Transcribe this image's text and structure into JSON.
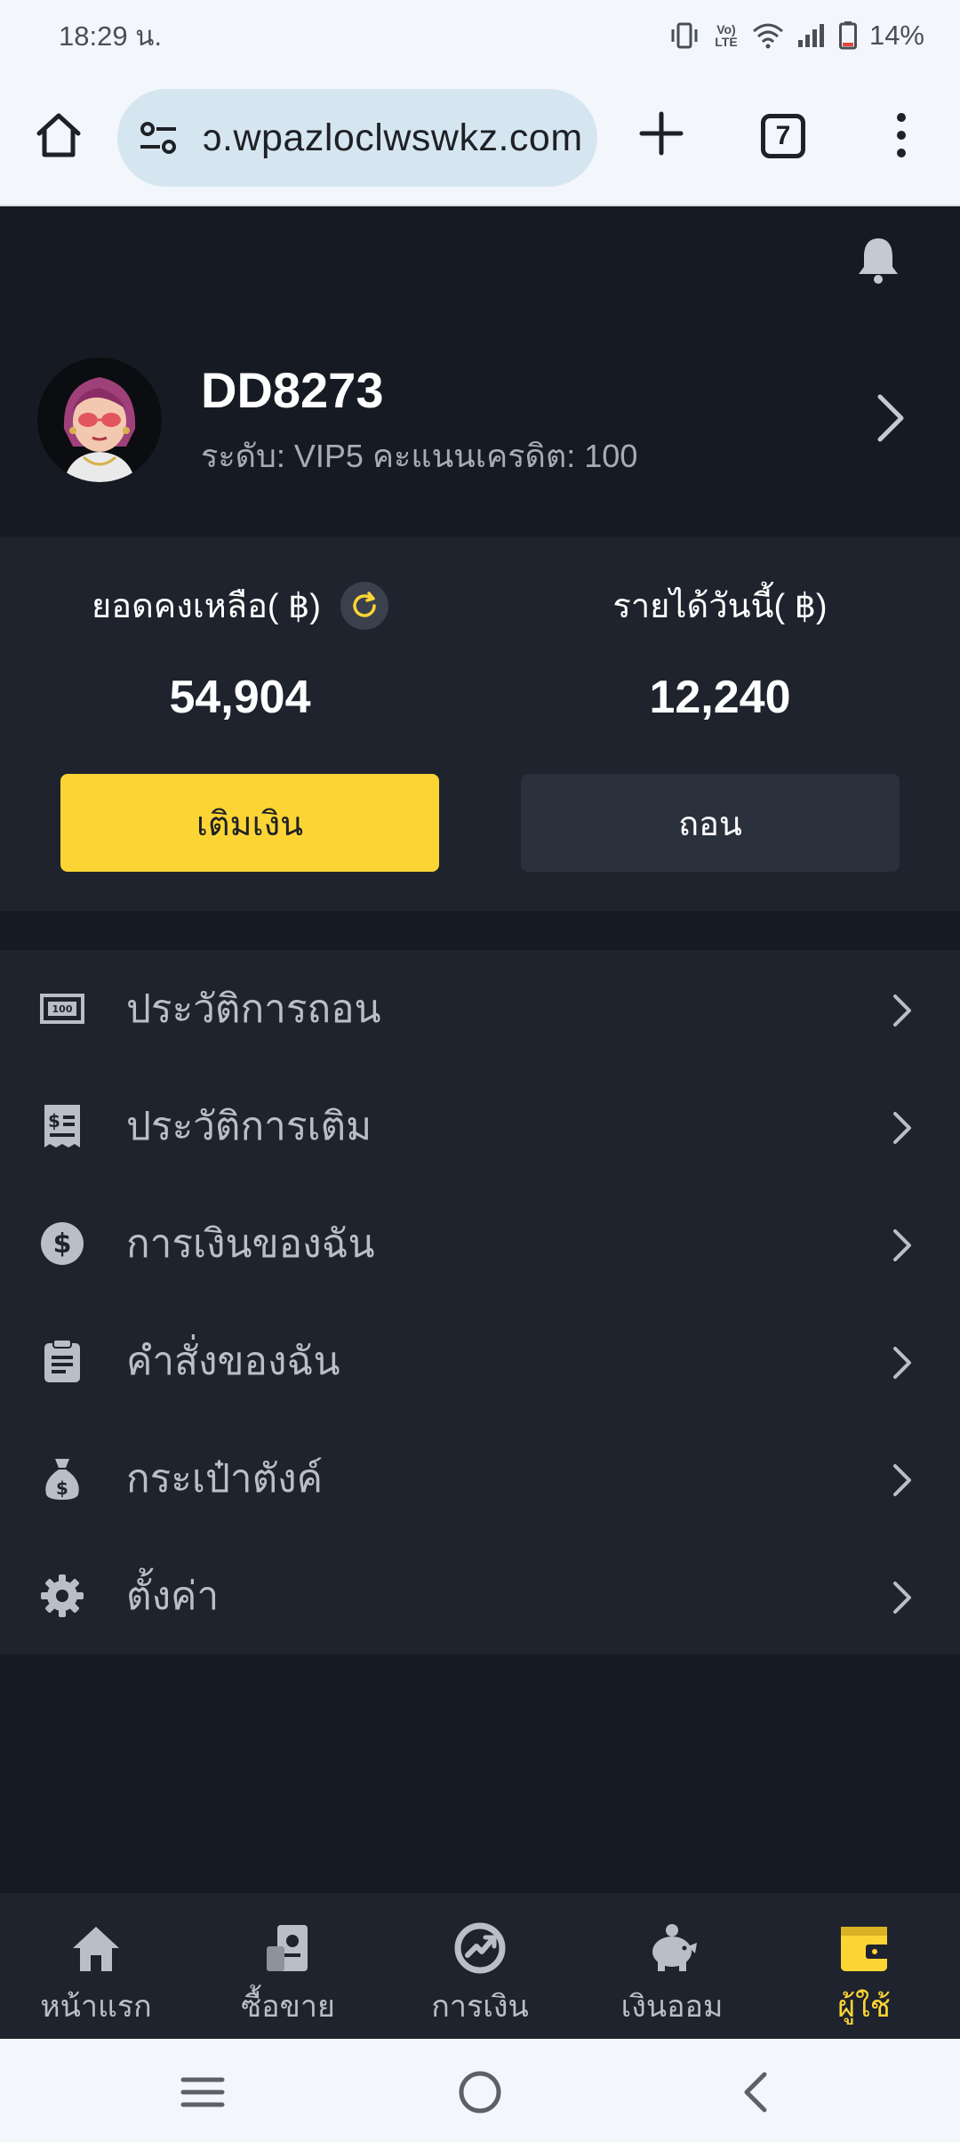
{
  "status_bar": {
    "time": "18:29 น.",
    "network": "Vo) LTE",
    "battery": "14%"
  },
  "browser": {
    "url": "ɔ.wpazloclwswkz.com",
    "tab_count": "7"
  },
  "profile": {
    "username": "DD8273",
    "meta": "ระดับ:  VIP5  คะแนนเครดิต:  100"
  },
  "balance": {
    "balance_label": "ยอดคงเหลือ( ฿)",
    "balance_value": "54,904",
    "income_label": "รายได้วันนี้( ฿)",
    "income_value": "12,240",
    "deposit_label": "เติมเงิน",
    "withdraw_label": "ถอน"
  },
  "menu": {
    "items": [
      {
        "label": "ประวัติการถอน",
        "icon": "money-bill-icon"
      },
      {
        "label": "ประวัติการเติม",
        "icon": "receipt-icon"
      },
      {
        "label": "การเงินของฉัน",
        "icon": "dollar-coin-icon"
      },
      {
        "label": "คำสั่งของฉัน",
        "icon": "clipboard-icon"
      },
      {
        "label": "กระเป๋าตังค์",
        "icon": "money-bag-icon"
      },
      {
        "label": "ตั้งค่า",
        "icon": "gear-icon"
      }
    ]
  },
  "bottom_nav": {
    "items": [
      {
        "label": "หน้าแรก",
        "icon": "home-icon"
      },
      {
        "label": "ซื้อขาย",
        "icon": "trade-icon"
      },
      {
        "label": "การเงิน",
        "icon": "finance-icon"
      },
      {
        "label": "เงินออม",
        "icon": "piggy-bank-icon"
      },
      {
        "label": "ผู้ใช้",
        "icon": "wallet-icon",
        "active": true
      }
    ]
  },
  "colors": {
    "accent": "#fcd535",
    "background": "#161b23",
    "card": "#1e232d"
  }
}
